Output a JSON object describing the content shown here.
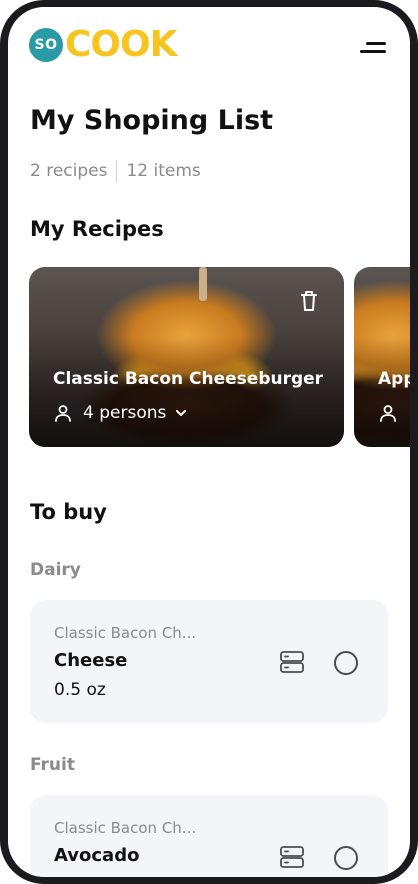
{
  "header": {
    "logo_badge": "SO",
    "logo_word": "COOK"
  },
  "page": {
    "title": "My Shoping List",
    "recipes_count": "2 recipes",
    "items_count": "12 items"
  },
  "sections": {
    "recipes_title": "My Recipes",
    "to_buy_title": "To buy"
  },
  "recipes": [
    {
      "name": "Classic Bacon Cheeseburger",
      "persons": "4 persons"
    },
    {
      "name": "App",
      "persons": ""
    }
  ],
  "categories": [
    {
      "name": "Dairy",
      "items": [
        {
          "recipe": "Classic Bacon Ch...",
          "name": "Cheese",
          "qty": "0.5 oz"
        }
      ]
    },
    {
      "name": "Fruit",
      "items": [
        {
          "recipe": "Classic Bacon Ch...",
          "name": "Avocado",
          "qty": ""
        }
      ]
    }
  ],
  "colors": {
    "brand_yellow": "#f6c521",
    "brand_teal": "#2a9aa6",
    "card_bg": "#f4f5f9",
    "muted_text": "#8a8a8f"
  },
  "icons": [
    "menu-icon",
    "trash-icon",
    "user-icon",
    "chevron-down-icon",
    "storage-icon",
    "checkbox-circle-icon"
  ]
}
